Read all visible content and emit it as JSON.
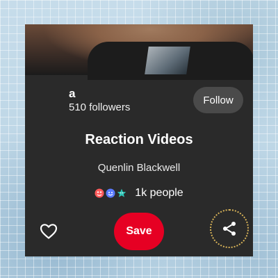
{
  "board": {
    "owner_name": "a",
    "followers": "510 followers",
    "follow_label": "Follow",
    "title": "Reaction Videos",
    "creator": "Quenlin Blackwell",
    "reaction_count": "1k people",
    "reaction_icons": [
      "heart-eyes-face-icon",
      "blue-smile-face-icon",
      "teal-star-face-icon"
    ],
    "save_label": "Save"
  },
  "colors": {
    "card_bg": "#2a2a2a",
    "save_button": "#e60023",
    "follow_button": "#4a4a4a",
    "background": "#bcd6e6"
  }
}
